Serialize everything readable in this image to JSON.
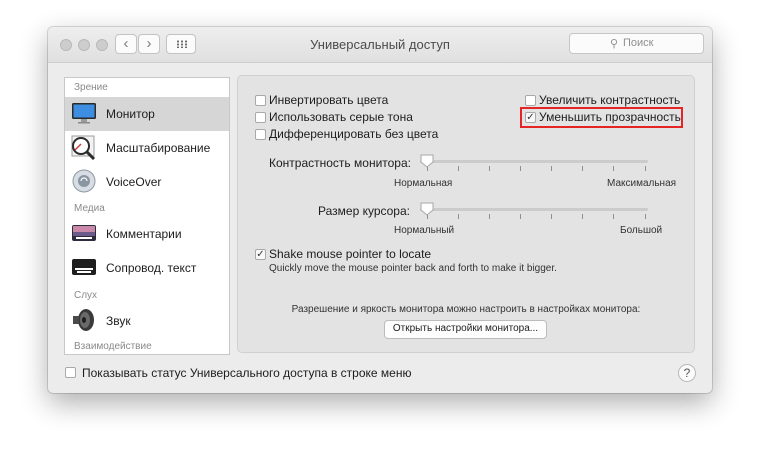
{
  "window": {
    "title": "Универсальный доступ",
    "back_label": "‹",
    "forward_label": "›",
    "search_placeholder": "Поиск",
    "search_icon": "⚲"
  },
  "sidebar": {
    "sections": [
      "Зрение",
      "Медиа",
      "Слух",
      "Взаимодействие"
    ],
    "items": [
      {
        "label": "Монитор",
        "icon": "monitor-icon",
        "selected": true
      },
      {
        "label": "Масштабирование",
        "icon": "zoom-icon"
      },
      {
        "label": "VoiceOver",
        "icon": "voiceover-icon"
      },
      {
        "label": "Комментарии",
        "icon": "comments-icon"
      },
      {
        "label": "Сопровод. текст",
        "icon": "captions-icon"
      },
      {
        "label": "Звук",
        "icon": "speaker-icon"
      }
    ]
  },
  "display": {
    "checkboxes": [
      {
        "label": "Инвертировать цвета",
        "checked": false
      },
      {
        "label": "Использовать серые тона",
        "checked": false
      },
      {
        "label": "Дифференцировать без цвета",
        "checked": false
      },
      {
        "label": "Увеличить контрастность",
        "checked": false
      },
      {
        "label": "Уменьшить прозрачность",
        "checked": true
      }
    ],
    "contrast": {
      "label": "Контрастность монитора:",
      "min_label": "Нормальная",
      "max_label": "Максимальная",
      "value": 0
    },
    "cursor": {
      "label": "Размер курсора:",
      "min_label": "Нормальный",
      "max_label": "Большой",
      "value": 0
    },
    "shake": {
      "label": "Shake mouse pointer to locate",
      "description": "Quickly move the mouse pointer back and forth to make it bigger.",
      "checked": true
    },
    "monitor_note": "Разрешение и яркость монитора можно настроить в настройках монитора:",
    "open_button": "Открыть настройки монитора..."
  },
  "footer": {
    "status_label": "Показывать статус Универсального доступа в строке меню",
    "status_checked": false,
    "help_label": "?"
  },
  "check_glyph": "✓",
  "colors": {
    "highlight": "#e32525",
    "selection": "#d6d6d6"
  }
}
